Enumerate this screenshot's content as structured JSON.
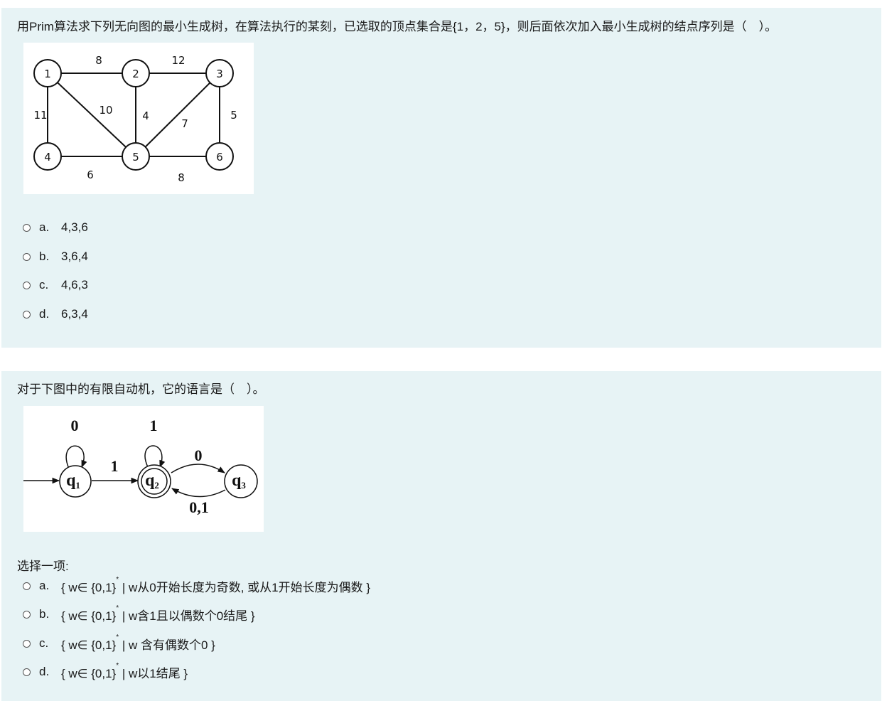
{
  "q1": {
    "text": "用Prim算法求下列无向图的最小生成树，在算法执行的某刻，已选取的顶点集合是{1，2，5}，则后面依次加入最小生成树的结点序列是（　）。",
    "graph": {
      "nodes": [
        "1",
        "2",
        "3",
        "4",
        "5",
        "6"
      ],
      "edge_labels": [
        "8",
        "12",
        "11",
        "10",
        "4",
        "7",
        "5",
        "6",
        "8"
      ]
    },
    "options": [
      {
        "letter": "a.",
        "text": "4,3,6"
      },
      {
        "letter": "b.",
        "text": "3,6,4"
      },
      {
        "letter": "c.",
        "text": "4,6,3"
      },
      {
        "letter": "d.",
        "text": "6,3,4"
      }
    ]
  },
  "q2": {
    "text": "对于下图中的有限自动机，它的语言是（　）。",
    "automaton": {
      "states": [
        "q",
        "q",
        "q"
      ],
      "state_subscripts": [
        "1",
        "2",
        "3"
      ],
      "labels": [
        "0",
        "1",
        "1",
        "0",
        "0,1"
      ]
    },
    "prompt": "选择一项:",
    "options": [
      {
        "letter": "a.",
        "pre": "{ w∈ {0,1}",
        "sup": "*",
        "post": " | w从0开始长度为奇数, 或从1开始长度为偶数 }"
      },
      {
        "letter": "b.",
        "pre": "{ w∈ {0,1}",
        "sup": "*",
        "post": " | w含1且以偶数个0结尾 }"
      },
      {
        "letter": "c.",
        "pre": "{ w∈ {0,1}",
        "sup": "*",
        "post": " | w 含有偶数个0 }"
      },
      {
        "letter": "d.",
        "pre": "{ w∈ {0,1}",
        "sup": "*",
        "post": " | w以1结尾 }"
      }
    ]
  }
}
